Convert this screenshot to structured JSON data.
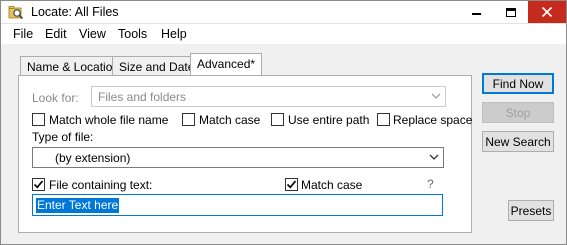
{
  "window": {
    "title": "Locate: All Files"
  },
  "menu": [
    "File",
    "Edit",
    "View",
    "Tools",
    "Help"
  ],
  "tabs": [
    {
      "label": "Name & Location",
      "active": false
    },
    {
      "label": "Size and Date",
      "active": false
    },
    {
      "label": "Advanced*",
      "active": true
    }
  ],
  "advanced": {
    "look_for_label": "Look for:",
    "look_for_value": "Files and folders",
    "options": [
      {
        "label": "Match whole file name",
        "checked": false
      },
      {
        "label": "Match case",
        "checked": false
      },
      {
        "label": "Use entire path",
        "checked": false
      },
      {
        "label": "Replace space",
        "checked": false
      }
    ],
    "type_label": "Type of file:",
    "type_value": "(by extension)",
    "containing_label": "File containing text:",
    "containing_checked": true,
    "match_case_label": "Match case",
    "match_case_checked": true,
    "help_glyph": "?",
    "text_value": "Enter Text here"
  },
  "buttons": {
    "find_now": "Find Now",
    "stop": "Stop",
    "new_search": "New Search",
    "presets": "Presets"
  },
  "colors": {
    "close": "#c42b1c",
    "accent": "#0078d7"
  }
}
